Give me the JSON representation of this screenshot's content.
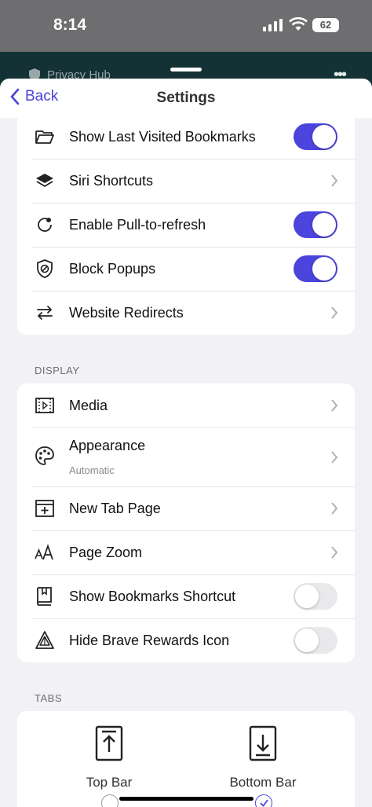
{
  "status_bar": {
    "time": "8:14",
    "battery": "62"
  },
  "background_page": {
    "title": "Privacy Hub"
  },
  "nav": {
    "back_label": "Back",
    "title": "Settings"
  },
  "general_rows": [
    {
      "label": "Show Last Visited Bookmarks",
      "icon": "folder-icon",
      "control": "toggle",
      "on": true
    },
    {
      "label": "Siri Shortcuts",
      "icon": "layers-icon",
      "control": "chevron"
    },
    {
      "label": "Enable Pull-to-refresh",
      "icon": "refresh-icon",
      "control": "toggle",
      "on": true
    },
    {
      "label": "Block Popups",
      "icon": "shield-block-icon",
      "control": "toggle",
      "on": true
    },
    {
      "label": "Website Redirects",
      "icon": "arrows-swap-icon",
      "control": "chevron"
    }
  ],
  "display": {
    "header": "DISPLAY",
    "rows": [
      {
        "label": "Media",
        "icon": "media-film-icon",
        "control": "chevron"
      },
      {
        "label": "Appearance",
        "subtitle": "Automatic",
        "icon": "palette-icon",
        "control": "chevron"
      },
      {
        "label": "New Tab Page",
        "icon": "new-tab-icon",
        "control": "chevron"
      },
      {
        "label": "Page Zoom",
        "icon": "text-size-icon",
        "control": "chevron"
      },
      {
        "label": "Show Bookmarks Shortcut",
        "icon": "bookmark-book-icon",
        "control": "toggle",
        "on": false
      },
      {
        "label": "Hide Brave Rewards Icon",
        "icon": "rewards-triangle-icon",
        "control": "toggle",
        "on": false
      }
    ]
  },
  "tabs": {
    "header": "TABS",
    "options": [
      {
        "label": "Top Bar",
        "selected": false
      },
      {
        "label": "Bottom Bar",
        "selected": true
      }
    ]
  },
  "colors": {
    "accent": "#4b45dd",
    "toggle_off": "#e9e9eb",
    "sheet_bg": "#f2f2f6"
  }
}
